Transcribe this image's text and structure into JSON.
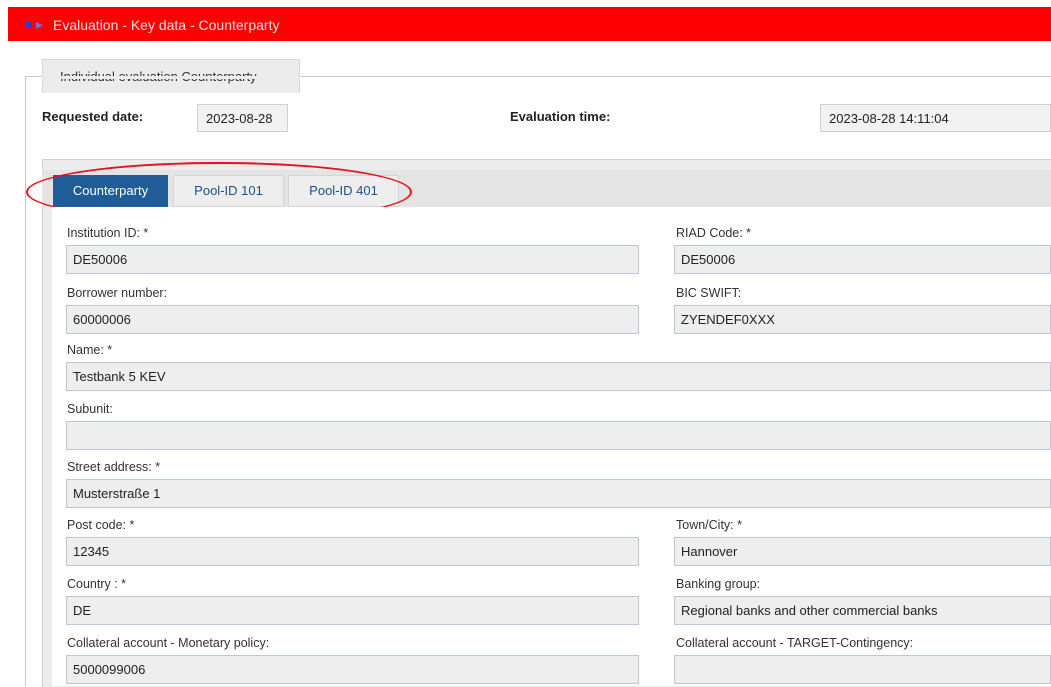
{
  "header": {
    "title": "Evaluation - Key data - Counterparty"
  },
  "section": {
    "legend": "Individual evaluation Counterparty"
  },
  "requested_date": {
    "label": "Requested date:",
    "value": "2023-08-28"
  },
  "evaluation_time": {
    "label": "Evaluation time:",
    "value": "2023-08-28 14:11:04"
  },
  "tabs": [
    {
      "label": "Counterparty",
      "active": true
    },
    {
      "label": "Pool-ID 101",
      "active": false
    },
    {
      "label": "Pool-ID 401",
      "active": false
    }
  ],
  "fields": {
    "institution_id": {
      "label": "Institution ID:  *",
      "value": "DE50006"
    },
    "riad_code": {
      "label": "RIAD Code:  *",
      "value": "DE50006"
    },
    "borrower_number": {
      "label": "Borrower number:",
      "value": "60000006"
    },
    "bic_swift": {
      "label": "BIC SWIFT:",
      "value": "ZYENDEF0XXX"
    },
    "name": {
      "label": "Name:  *",
      "value": "Testbank 5 KEV"
    },
    "subunit": {
      "label": "Subunit:",
      "value": ""
    },
    "street_address": {
      "label": "Street address:  *",
      "value": "Musterstraße 1"
    },
    "post_code": {
      "label": "Post code:  *",
      "value": "12345"
    },
    "town_city": {
      "label": "Town/City:  *",
      "value": "Hannover"
    },
    "country": {
      "label": "Country :  *",
      "value": "DE"
    },
    "banking_group": {
      "label": "Banking group:",
      "value": "Regional banks and other commercial banks"
    },
    "collateral_monetary": {
      "label": "Collateral account - Monetary policy:",
      "value": "5000099006"
    },
    "collateral_target": {
      "label": "Collateral account - TARGET-Contingency:",
      "value": ""
    }
  },
  "colors": {
    "header_bg": "#ff0000",
    "active_tab": "#1f5c98",
    "highlight_ellipse": "#e8101e"
  }
}
